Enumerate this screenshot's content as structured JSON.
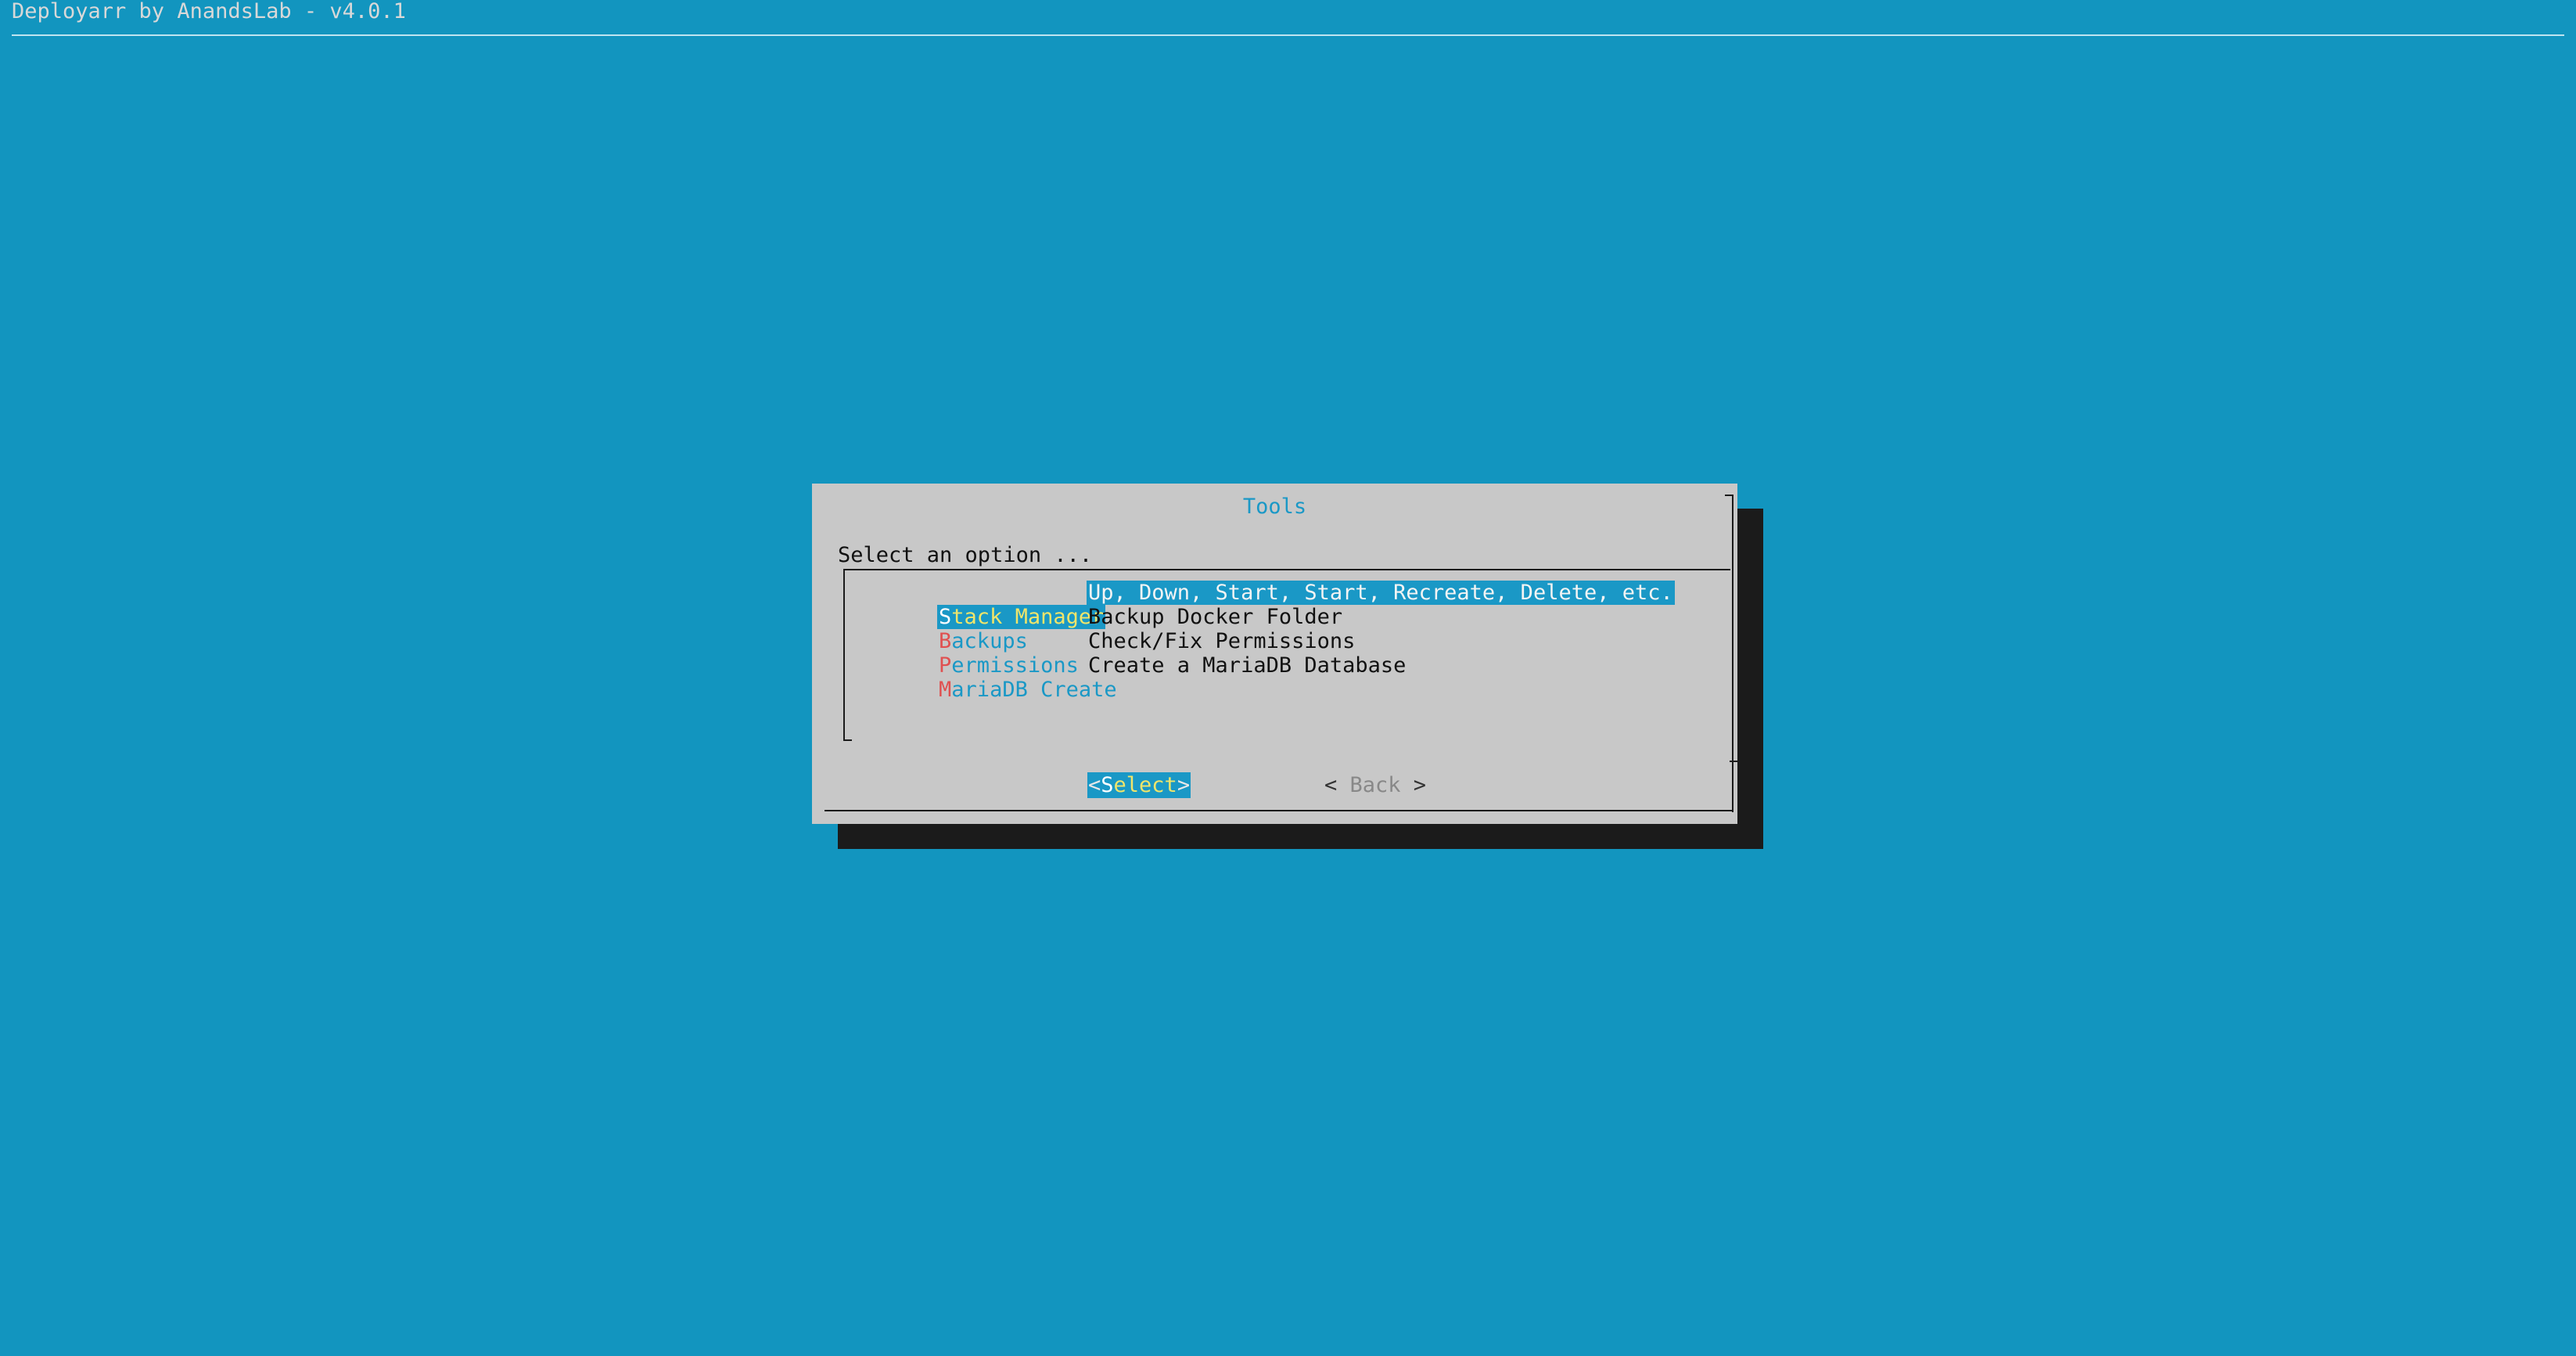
{
  "backtitle": "Deployarr by AnandsLab - v4.0.1",
  "dialog": {
    "title": "Tools",
    "prompt": "Select an option ...",
    "items": [
      {
        "hotkey": "S",
        "rest": "tack Manager",
        "description": "Up, Down, Start, Start, Recreate, Delete, etc.",
        "selected": true
      },
      {
        "hotkey": "B",
        "rest": "ackups",
        "description": "Backup Docker Folder",
        "selected": false
      },
      {
        "hotkey": "P",
        "rest": "ermissions",
        "description": "Check/Fix Permissions",
        "selected": false
      },
      {
        "hotkey": "M",
        "rest": "ariaDB Create",
        "description": "Create a MariaDB Database",
        "selected": false
      }
    ],
    "buttons": {
      "select": {
        "open": "<",
        "hotkey": "S",
        "rest": "elect",
        "close": ">"
      },
      "back": {
        "open": "< ",
        "label": "Back",
        "close": " >"
      }
    }
  },
  "colors": {
    "background": "#1295BF",
    "dialog": "#C8C8C8",
    "shadow": "#1B1B1B",
    "accent": "#1A98C6",
    "selected_text": "#F0E56A",
    "hotkey": "#E05050"
  }
}
